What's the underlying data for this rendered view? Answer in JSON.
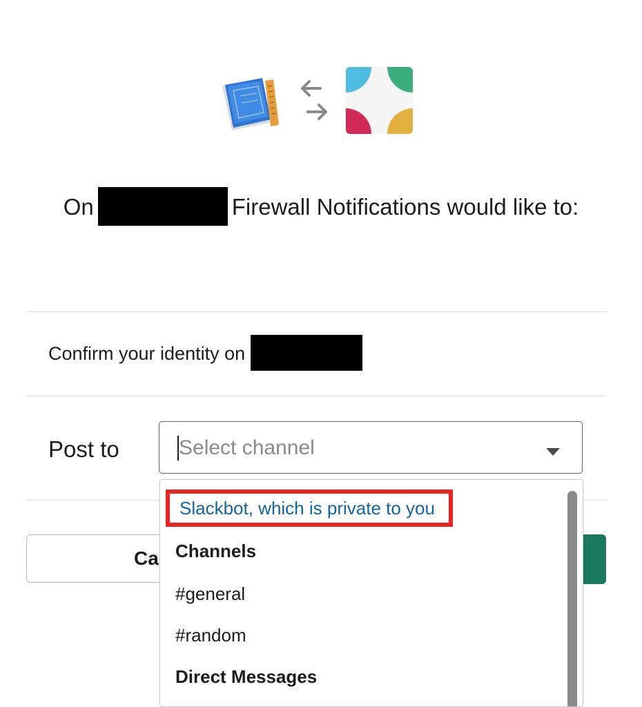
{
  "icons": {
    "app": "blueprint-app-icon",
    "exchange": "exchange-arrows-icon",
    "slack": "slack-logo-icon"
  },
  "heading": {
    "prefix": "On",
    "redacted": "",
    "suffix": "Firewall Notifications would like to:"
  },
  "permissions": {
    "confirm_identity": "Confirm your identity on"
  },
  "post_to": {
    "label": "Post to",
    "placeholder": "Select channel"
  },
  "buttons": {
    "cancel_partial": "Ca"
  },
  "dropdown": {
    "highlighted_option": "Slackbot, which is private to you",
    "channels_header": "Channels",
    "channels": [
      "#general",
      "#random"
    ],
    "direct_messages_header": "Direct Messages"
  },
  "colors": {
    "link_blue": "#1264a3",
    "highlight_red": "#e8241c",
    "allow_green": "#1b7a5c",
    "slack_blue": "#4fbde0",
    "slack_green": "#3aae7c",
    "slack_red": "#d12a57",
    "slack_yellow": "#e2b03f"
  }
}
